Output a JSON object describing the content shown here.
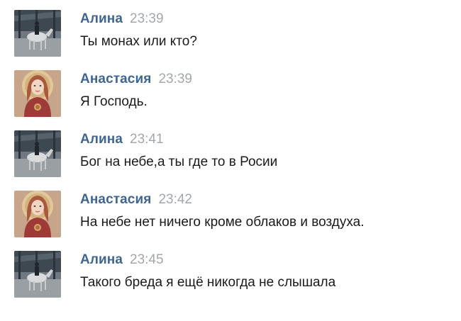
{
  "messages": [
    {
      "author": "Алина",
      "time": "23:39",
      "text": "Ты монах или кто?",
      "avatar": "horse-rider-avatar"
    },
    {
      "author": "Анастасия",
      "time": "23:39",
      "text": "Я Господь.",
      "avatar": "icon-portrait-avatar"
    },
    {
      "author": "Алина",
      "time": "23:41",
      "text": "Бог на небе,а ты где то в Росии",
      "avatar": "horse-rider-avatar"
    },
    {
      "author": "Анастасия",
      "time": "23:42",
      "text": "На небе нет ничего кроме облаков и воздуха.",
      "avatar": "icon-portrait-avatar"
    },
    {
      "author": "Алина",
      "time": "23:45",
      "text": "Такого бреда я ещё никогда не слышала",
      "avatar": "horse-rider-avatar"
    }
  ],
  "colors": {
    "author": "#3f6592",
    "time": "#a3a7ad",
    "text": "#1a1a1a",
    "background": "#ffffff"
  }
}
